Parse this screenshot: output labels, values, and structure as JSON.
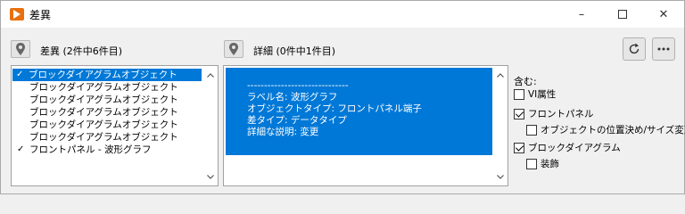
{
  "window": {
    "title": "差異",
    "minimize_icon": "minimize-icon",
    "maximize_icon": "maximize-icon",
    "close_icon": "close-icon"
  },
  "differences": {
    "header": "差異 (2件中6件目)",
    "items": [
      {
        "label": "ブロックダイアグラムオブジェクト",
        "checked": true,
        "selected": true
      },
      {
        "label": "ブロックダイアグラムオブジェクト",
        "checked": false,
        "selected": false
      },
      {
        "label": "ブロックダイアグラムオブジェクト",
        "checked": false,
        "selected": false
      },
      {
        "label": "ブロックダイアグラムオブジェクト",
        "checked": false,
        "selected": false
      },
      {
        "label": "ブロックダイアグラムオブジェクト",
        "checked": false,
        "selected": false
      },
      {
        "label": "ブロックダイアグラムオブジェクト",
        "checked": false,
        "selected": false
      },
      {
        "label": "フロントパネル - 波形グラフ",
        "checked": true,
        "selected": false
      }
    ]
  },
  "details": {
    "header": "詳細 (0件中1件目)",
    "lines": [
      "------------------------------",
      "ラベル名: 波形グラフ",
      "オブジェクトタイプ: フロントパネル端子",
      "差タイプ: データタイプ",
      "詳細な説明: 変更"
    ]
  },
  "options": {
    "title": "含む:",
    "items": [
      {
        "label": "VI属性",
        "checked": false
      },
      {
        "label": "フロントパネル",
        "checked": true
      },
      {
        "label": "オブジェクトの位置決め/サイズ変更",
        "checked": false
      },
      {
        "label": "ブロックダイアグラム",
        "checked": true
      },
      {
        "label": "装飾",
        "checked": false
      }
    ]
  },
  "toolbar": {
    "refresh_icon": "refresh-icon",
    "more_icon": "more-icon"
  },
  "colors": {
    "selection": "#0078d7",
    "app_icon": "#e8700f"
  }
}
